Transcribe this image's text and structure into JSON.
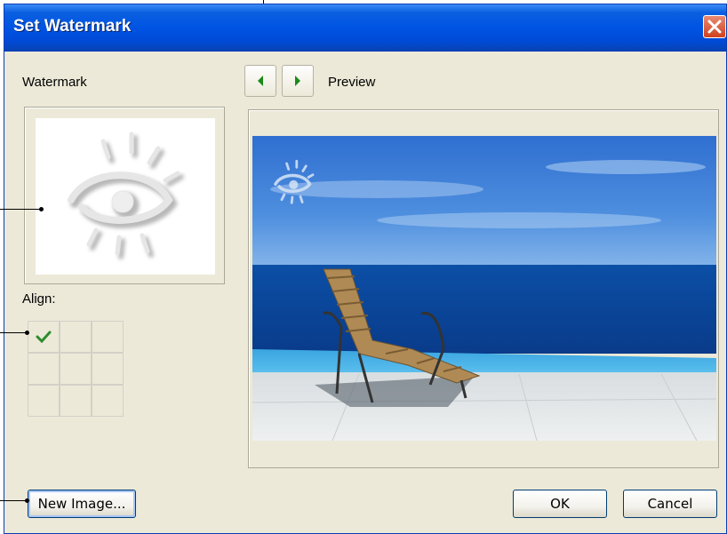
{
  "dialog": {
    "title": "Set Watermark",
    "close_icon": "close-icon"
  },
  "left": {
    "watermark_label": "Watermark",
    "align_label": "Align:",
    "align_selected_cell": "top-left",
    "watermark_icon": "eye-sun-icon"
  },
  "preview": {
    "label": "Preview",
    "prev_icon": "arrow-left-icon",
    "next_icon": "arrow-right-icon"
  },
  "buttons": {
    "new_image": "New Image...",
    "ok": "OK",
    "cancel": "Cancel"
  },
  "colors": {
    "titlebar": "#0054e3",
    "window_bg": "#ece9d8",
    "arrow_green": "#1a8a1a",
    "check_green": "#2e8b2e"
  }
}
